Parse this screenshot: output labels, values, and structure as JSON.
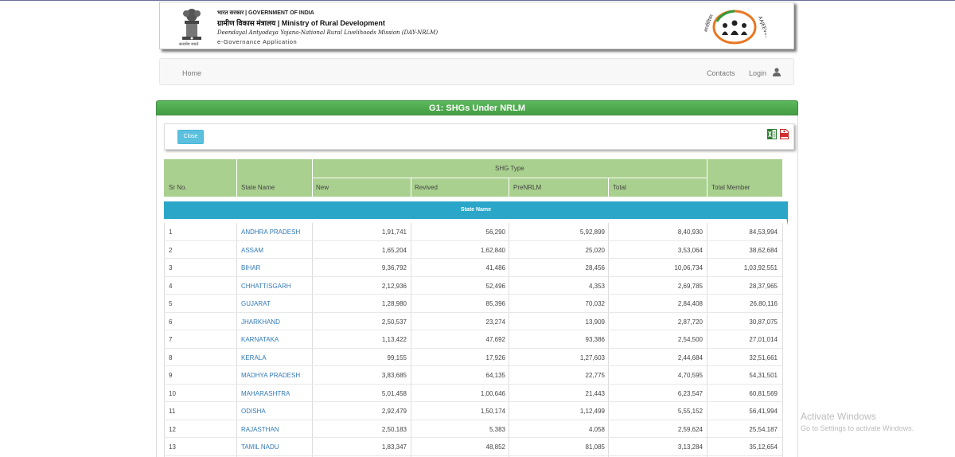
{
  "header": {
    "line1": "भारत सरकार | GOVERNMENT OF INDIA",
    "line2": "ग्रामीण विकास मंत्रालय | Ministry of Rural Development",
    "line3": "Deendayal Antyodaya Yojana-National Rural Livelihoods Mission (DAY-NRLM)",
    "line4": "e-Governance Application",
    "emblem_caption": "सत्यमेव जयते"
  },
  "nav": {
    "home": "Home",
    "contacts": "Contacts",
    "login": "Login"
  },
  "panel": {
    "title": "G1:  SHGs Under NRLM",
    "close_label": "Close"
  },
  "table": {
    "group_header": "SHG Type",
    "columns": {
      "sr": "Sr No.",
      "state": "State Name",
      "new": "New",
      "revived": "Revived",
      "prenrlm": "PreNRLM",
      "total": "Total",
      "total_member": "Total Member"
    },
    "subheader": "State Name",
    "rows": [
      {
        "sr": "1",
        "state": "ANDHRA PRADESH",
        "new": "1,91,741",
        "revived": "56,290",
        "prenrlm": "5,92,899",
        "total": "8,40,930",
        "member": "84,53,994"
      },
      {
        "sr": "2",
        "state": "ASSAM",
        "new": "1,65,204",
        "revived": "1,62,840",
        "prenrlm": "25,020",
        "total": "3,53,064",
        "member": "38,62,684"
      },
      {
        "sr": "3",
        "state": "BIHAR",
        "new": "9,36,792",
        "revived": "41,486",
        "prenrlm": "28,456",
        "total": "10,06,734",
        "member": "1,03,92,551"
      },
      {
        "sr": "4",
        "state": "CHHATTISGARH",
        "new": "2,12,936",
        "revived": "52,496",
        "prenrlm": "4,353",
        "total": "2,69,785",
        "member": "28,37,965"
      },
      {
        "sr": "5",
        "state": "GUJARAT",
        "new": "1,28,980",
        "revived": "85,396",
        "prenrlm": "70,032",
        "total": "2,84,408",
        "member": "26,80,116"
      },
      {
        "sr": "6",
        "state": "JHARKHAND",
        "new": "2,50,537",
        "revived": "23,274",
        "prenrlm": "13,909",
        "total": "2,87,720",
        "member": "30,87,075"
      },
      {
        "sr": "7",
        "state": "KARNATAKA",
        "new": "1,13,422",
        "revived": "47,692",
        "prenrlm": "93,386",
        "total": "2,54,500",
        "member": "27,01,014"
      },
      {
        "sr": "8",
        "state": "KERALA",
        "new": "99,155",
        "revived": "17,926",
        "prenrlm": "1,27,603",
        "total": "2,44,684",
        "member": "32,51,661"
      },
      {
        "sr": "9",
        "state": "MADHYA PRADESH",
        "new": "3,83,685",
        "revived": "64,135",
        "prenrlm": "22,775",
        "total": "4,70,595",
        "member": "54,31,501"
      },
      {
        "sr": "10",
        "state": "MAHARASHTRA",
        "new": "5,01,458",
        "revived": "1,00,646",
        "prenrlm": "21,443",
        "total": "6,23,547",
        "member": "60,81,569"
      },
      {
        "sr": "11",
        "state": "ODISHA",
        "new": "2,92,479",
        "revived": "1,50,174",
        "prenrlm": "1,12,499",
        "total": "5,55,152",
        "member": "56,41,994"
      },
      {
        "sr": "12",
        "state": "RAJASTHAN",
        "new": "2,50,183",
        "revived": "5,383",
        "prenrlm": "4,058",
        "total": "2,59,624",
        "member": "25,54,187"
      },
      {
        "sr": "13",
        "state": "TAMIL NADU",
        "new": "1,83,347",
        "revived": "48,852",
        "prenrlm": "81,085",
        "total": "3,13,284",
        "member": "35,12,654"
      }
    ]
  },
  "watermark": {
    "title": "Activate Windows",
    "subtitle": "Go to Settings to activate Windows."
  },
  "colors": {
    "panel_green": "#5cb85c",
    "table_header": "#a9d08e",
    "teal": "#2aa6c8",
    "link": "#337ab7",
    "button": "#5bc0de"
  }
}
